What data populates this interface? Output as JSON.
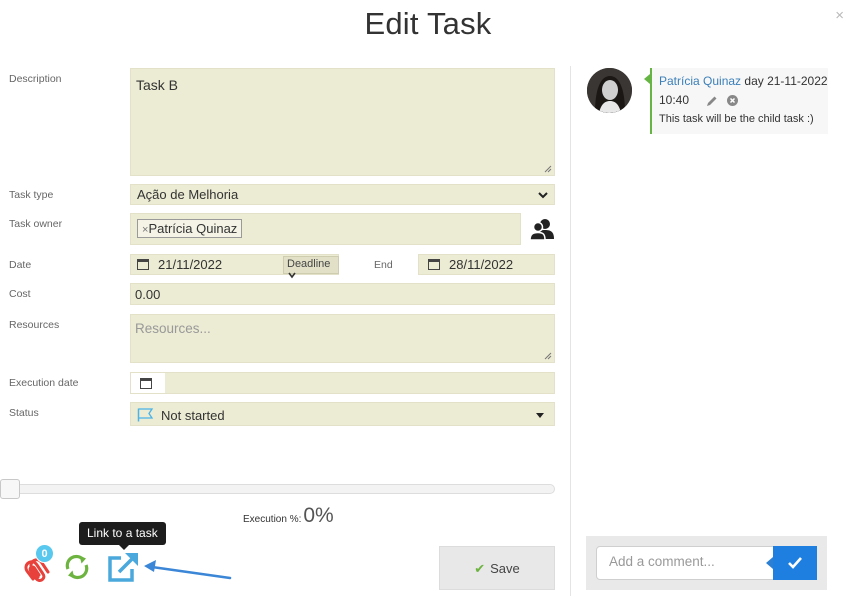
{
  "dialog": {
    "title": "Edit Task",
    "close_glyph": "×"
  },
  "form": {
    "labels": {
      "description": "Description",
      "task_type": "Task type",
      "task_owner": "Task owner",
      "date": "Date",
      "end": "End",
      "cost": "Cost",
      "resources": "Resources",
      "execution_date": "Execution date",
      "status": "Status"
    },
    "description_value": "Task B",
    "task_type_value": "Ação de Melhoria",
    "owner_chip": {
      "remove_glyph": "×",
      "name": "Patrícia Quinaz"
    },
    "start_date": "21/11/2022",
    "date_mode": "Deadline",
    "end_date": "28/11/2022",
    "cost_value": "0.00",
    "resources_placeholder": "Resources...",
    "execution_date_value": "",
    "status_value": "Not started",
    "status_flag_color": "#4ab3e8"
  },
  "progress": {
    "label": "Execution %:",
    "value_text": "0%",
    "fraction": 0
  },
  "actions": {
    "attachments_count": "0",
    "tooltip": "Link to a task",
    "save_label": "Save",
    "icons": [
      "paperclip-icon",
      "refresh-icon",
      "external-link-icon"
    ],
    "colors": {
      "paperclip": "#e8413b",
      "refresh": "#6cb33f",
      "link": "#4aa8dc",
      "badge": "#59c8ee"
    }
  },
  "comments": {
    "items": [
      {
        "author": "Patrícia Quinaz",
        "day_text": "day 21-11-2022",
        "time": "10:40",
        "text": "This task will be the child task :)"
      }
    ],
    "input_placeholder": "Add a comment...",
    "send_color": "#1f7fe0"
  },
  "colors": {
    "field_bg": "#ecebd4",
    "comment_accent": "#66b544",
    "author_link": "#3b7fb8"
  }
}
